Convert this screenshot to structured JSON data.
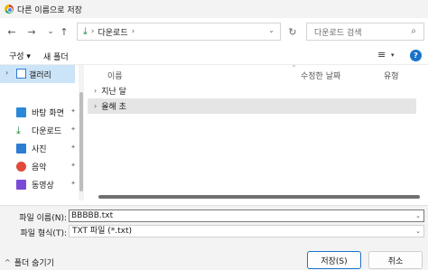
{
  "window": {
    "title": "다른 이름으로 저장"
  },
  "nav": {
    "back_icon": "←",
    "forward_icon": "→",
    "dropdown_icon": "⌄",
    "up_icon": "↑",
    "breadcrumb": "다운로드",
    "breadcrumb_sep": "›",
    "refresh_icon": "↻",
    "search_placeholder": "다운로드 검색",
    "search_icon": "⌕"
  },
  "toolbar": {
    "organize_label": "구성 ▾",
    "new_folder_label": "새 폴더",
    "view_icon": "≡",
    "view_dropdown": "▾",
    "help_label": "?"
  },
  "sidebar": {
    "gallery_label": "갤러리",
    "items": [
      {
        "label": "바탕 화면",
        "icon": "desktop-icon",
        "color": "#2b88d8"
      },
      {
        "label": "다운로드",
        "icon": "download-icon",
        "color": "#1e8a3a"
      },
      {
        "label": "사진",
        "icon": "pictures-icon",
        "color": "#2d7dd2"
      },
      {
        "label": "음악",
        "icon": "music-icon",
        "color": "#e04a3a"
      },
      {
        "label": "동영상",
        "icon": "videos-icon",
        "color": "#7a4bd8"
      }
    ],
    "pin_glyph": "📌"
  },
  "content": {
    "columns": {
      "name": "이름",
      "modified": "수정한 날짜",
      "type": "유형"
    },
    "groups": [
      {
        "label": "지난 달",
        "selected": false
      },
      {
        "label": "올해 초",
        "selected": true
      }
    ]
  },
  "form": {
    "filename_label": "파일 이름(N):",
    "filename_value": "BBBBB.txt",
    "filetype_label": "파일 형식(T):",
    "filetype_value": "TXT 파일 (*.txt)"
  },
  "footer": {
    "hide_folders_label": "폴더 숨기기",
    "save_label": "저장(S)",
    "cancel_label": "취소"
  }
}
